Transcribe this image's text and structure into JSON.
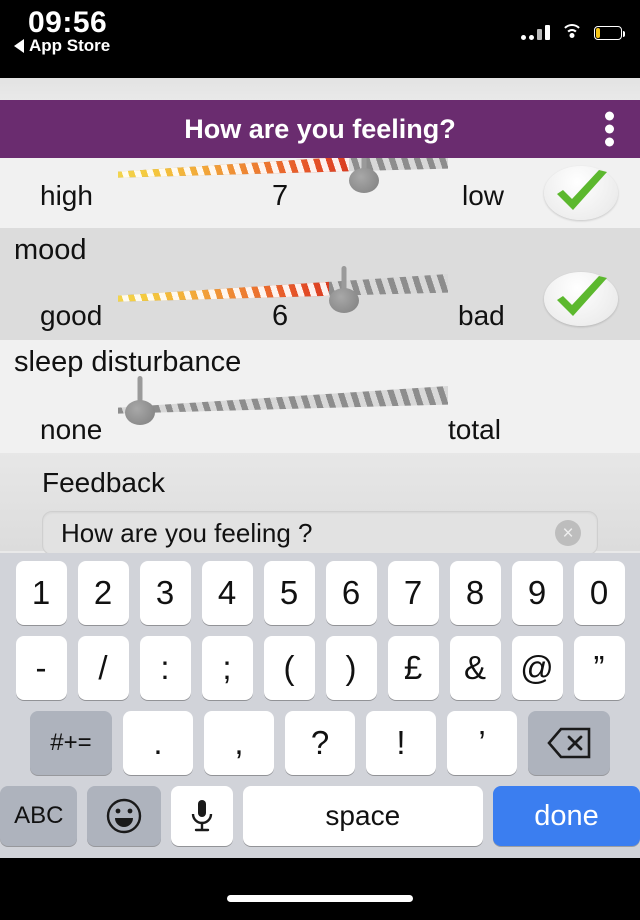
{
  "status_bar": {
    "time": "09:56",
    "back_label": "App Store",
    "back_icon": "triangle-left-icon",
    "signal_icon": "cellular-signal-icon",
    "wifi_icon": "wifi-icon",
    "battery_icon": "battery-low-icon",
    "battery_level_percent": 15,
    "battery_color": "#f5c518"
  },
  "header": {
    "title": "How are you feeling?",
    "background_color": "#6a2c6f",
    "menu_icon": "overflow-menu-icon"
  },
  "sliders": [
    {
      "label": "",
      "low_label": "high",
      "high_label": "low",
      "value": "7",
      "value_number": 7,
      "min": 0,
      "max": 10,
      "confirmed": true,
      "check_icon": "check-mark-icon",
      "check_color": "#5cb82e",
      "row_shade": "light",
      "clipped": true
    },
    {
      "label": "mood",
      "low_label": "good",
      "high_label": "bad",
      "value": "6",
      "value_number": 6,
      "min": 0,
      "max": 10,
      "confirmed": true,
      "check_icon": "check-mark-icon",
      "check_color": "#5cb82e",
      "row_shade": "dark",
      "clipped": false
    },
    {
      "label": "sleep disturbance",
      "low_label": "none",
      "high_label": "total",
      "value": "",
      "value_number": 0,
      "min": 0,
      "max": 10,
      "confirmed": false,
      "check_icon": "",
      "check_color": "",
      "row_shade": "light",
      "clipped": false
    }
  ],
  "feedback": {
    "label": "Feedback",
    "input_value": "How are you feeling ?",
    "input_placeholder": "How are you feeling ?",
    "clear_icon": "clear-circle-icon",
    "clear_glyph": "×"
  },
  "keyboard": {
    "row1": [
      "1",
      "2",
      "3",
      "4",
      "5",
      "6",
      "7",
      "8",
      "9",
      "0"
    ],
    "row2": [
      "-",
      "/",
      ":",
      ";",
      "(",
      ")",
      "£",
      "&",
      "@",
      "”"
    ],
    "row3_sym_label": "#+=",
    "row3": [
      ".",
      ",",
      "?",
      "!",
      "’"
    ],
    "row3_backspace_icon": "backspace-icon",
    "row4": {
      "abc_label": "ABC",
      "emoji_icon": "emoji-smiley-icon",
      "emoji_glyph": "☺",
      "mic_icon": "microphone-icon",
      "space_label": "space",
      "done_label": "done",
      "done_color": "#3b7ef0"
    }
  },
  "home_indicator": "home-indicator-bar"
}
